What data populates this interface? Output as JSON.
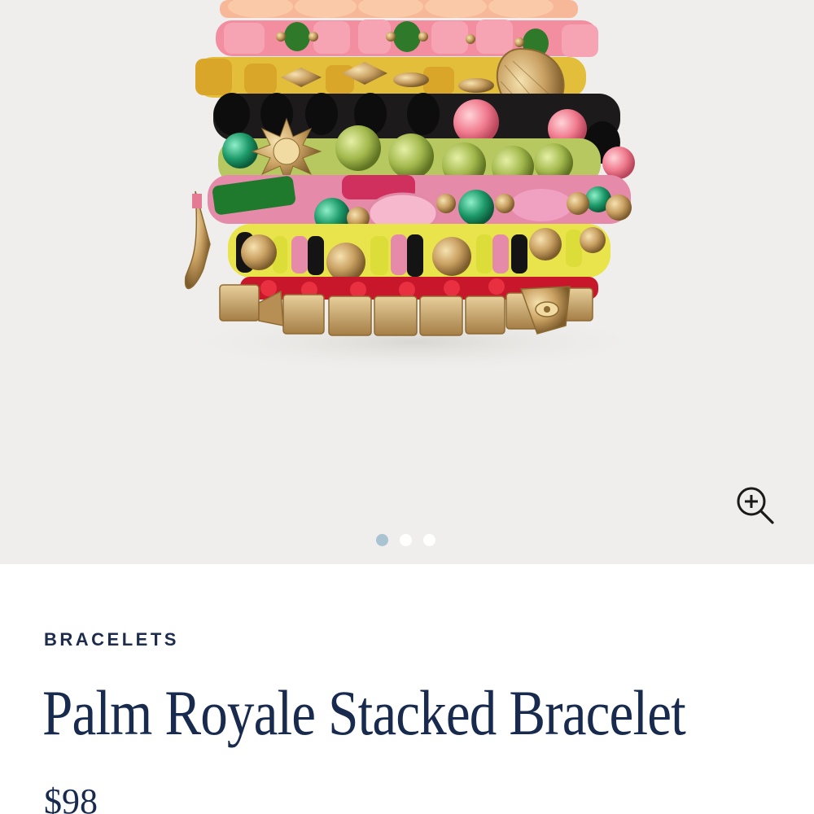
{
  "gallery": {
    "image_alt": "Palm Royale Stacked Bracelet",
    "zoom_icon": "zoom-in-icon",
    "slides": [
      {
        "active": true
      },
      {
        "active": false
      },
      {
        "active": false
      }
    ]
  },
  "product": {
    "category": "BRACELETS",
    "title": "Palm Royale Stacked Bracelet",
    "price": "$98"
  },
  "colors": {
    "text": "#182a4d",
    "gallery_bg": "#efeeec",
    "active_dot": "#a9c3d3",
    "inactive_dot": "#ffffff"
  }
}
